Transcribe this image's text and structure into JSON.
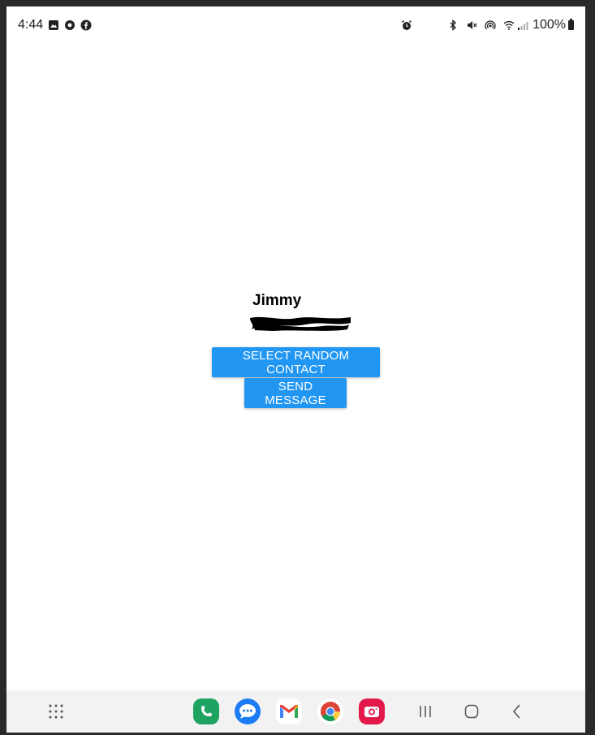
{
  "status_bar": {
    "time": "4:44",
    "battery": "100%",
    "left_icons": [
      "gallery-icon",
      "chrome-icon",
      "facebook-icon"
    ],
    "right_icons": [
      "alarm-icon",
      "bluetooth-icon",
      "mute-icon",
      "hotspot-icon",
      "wifi-icon",
      "signal-icon",
      "battery-icon"
    ]
  },
  "contact": {
    "name": "Jimmy"
  },
  "buttons": {
    "select_random": "SELECT RANDOM CONTACT",
    "send_message": "SEND MESSAGE"
  },
  "dock": {
    "apps": [
      "phone-app-icon",
      "messages-app-icon",
      "gmail-app-icon",
      "chrome-app-icon",
      "camera-app-icon"
    ]
  },
  "colors": {
    "button": "#2196f3",
    "phone": "#1ea362",
    "messages": "#1b7cf3",
    "camera": "#e3194b"
  }
}
